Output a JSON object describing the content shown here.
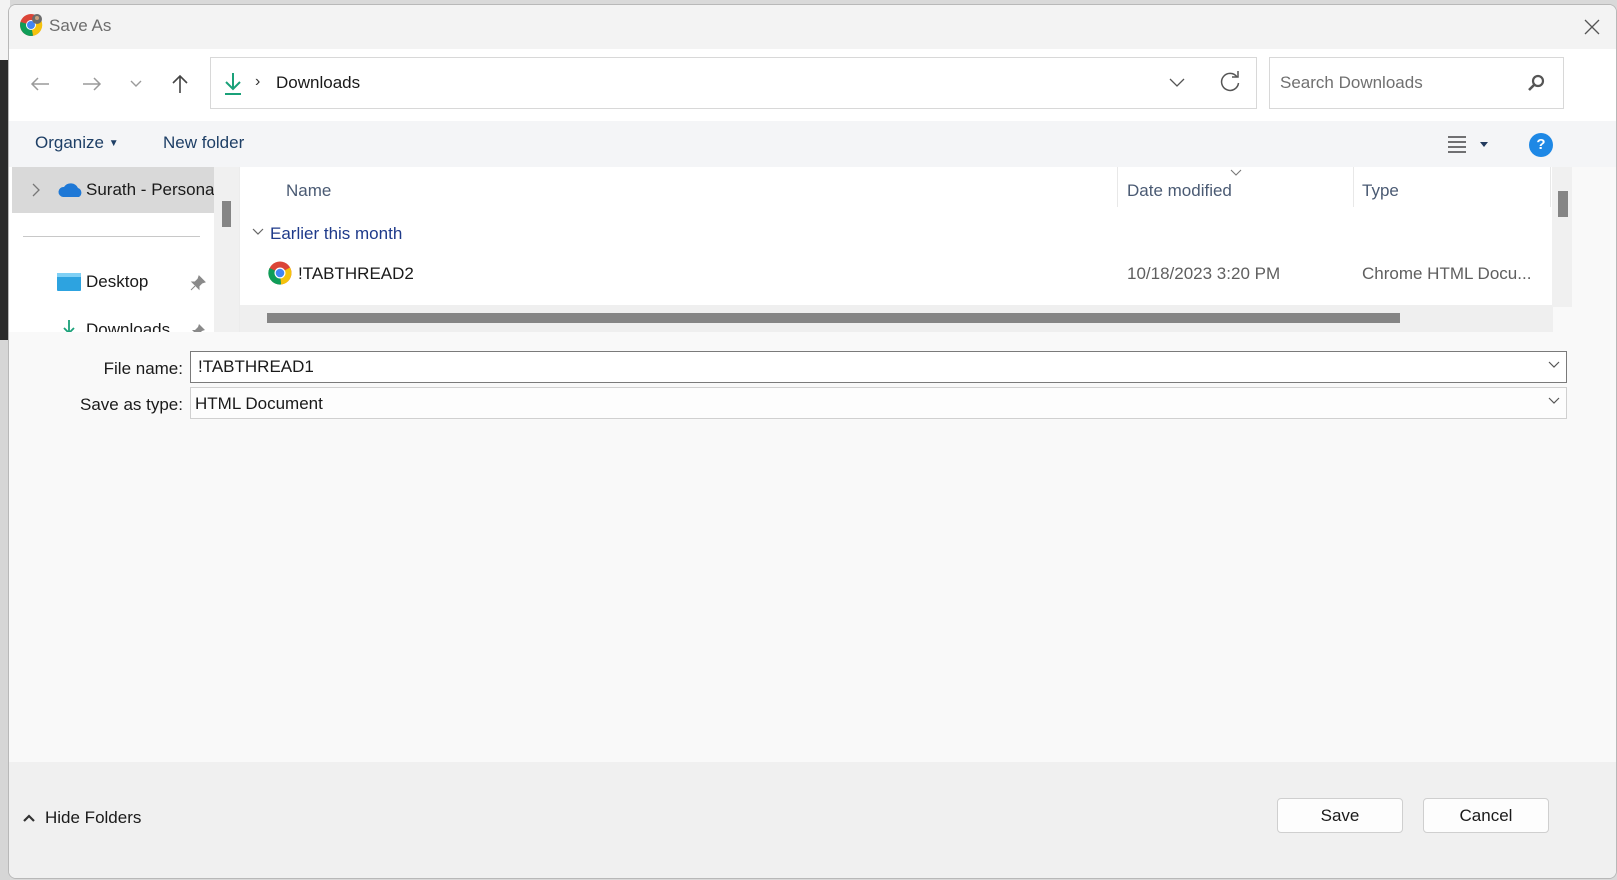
{
  "window": {
    "title": "Save As",
    "close_label": "Close"
  },
  "nav": {
    "back_label": "Back",
    "forward_label": "Forward",
    "recent_label": "Recent locations",
    "up_label": "Up",
    "address": {
      "separator": "›",
      "current": "Downloads"
    },
    "search_placeholder": "Search Downloads"
  },
  "toolbar": {
    "organize": "Organize",
    "new_folder": "New folder",
    "help": "?"
  },
  "sidebar": {
    "items": [
      {
        "label": "Surath - Personal",
        "icon": "onedrive-icon",
        "selected": true
      },
      {
        "label": "Desktop",
        "icon": "desktop-icon",
        "pinned": true
      },
      {
        "label": "Downloads",
        "icon": "download-icon",
        "pinned": true
      }
    ]
  },
  "file_list": {
    "columns": [
      "Name",
      "Date modified",
      "Type"
    ],
    "sorted_by": "Date modified",
    "groups": [
      {
        "label": "Earlier this month",
        "files": [
          {
            "name": "!TABTHREAD2",
            "date_modified": "10/18/2023 3:20 PM",
            "type": "Chrome HTML Docu...",
            "icon": "chrome-icon"
          }
        ]
      }
    ]
  },
  "form": {
    "file_name_label": "File name:",
    "file_name_value": "!TABTHREAD1",
    "save_type_label": "Save as type:",
    "save_type_value": "HTML Document"
  },
  "footer": {
    "hide_folders": "Hide Folders",
    "save": "Save",
    "cancel": "Cancel"
  },
  "colors": {
    "accent_blue": "#1e88e5",
    "link_blue": "#1e3a8a",
    "download_green": "#1aa179"
  }
}
